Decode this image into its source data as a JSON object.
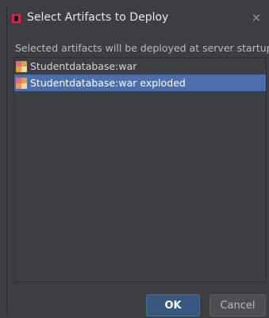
{
  "dialog": {
    "title": "Select Artifacts to Deploy",
    "close_glyph": "×",
    "description": "Selected artifacts will be deployed at server startup",
    "artifacts": [
      {
        "label": "Studentdatabase:war",
        "selected": false,
        "icon": "war-artifact-icon"
      },
      {
        "label": "Studentdatabase:war exploded",
        "selected": true,
        "icon": "war-exploded-artifact-icon"
      }
    ],
    "buttons": {
      "ok_label": "OK",
      "cancel_label": "Cancel"
    }
  },
  "colors": {
    "background": "#3c3f41",
    "selection": "#4b6eaf",
    "ok_button": "#365880"
  }
}
